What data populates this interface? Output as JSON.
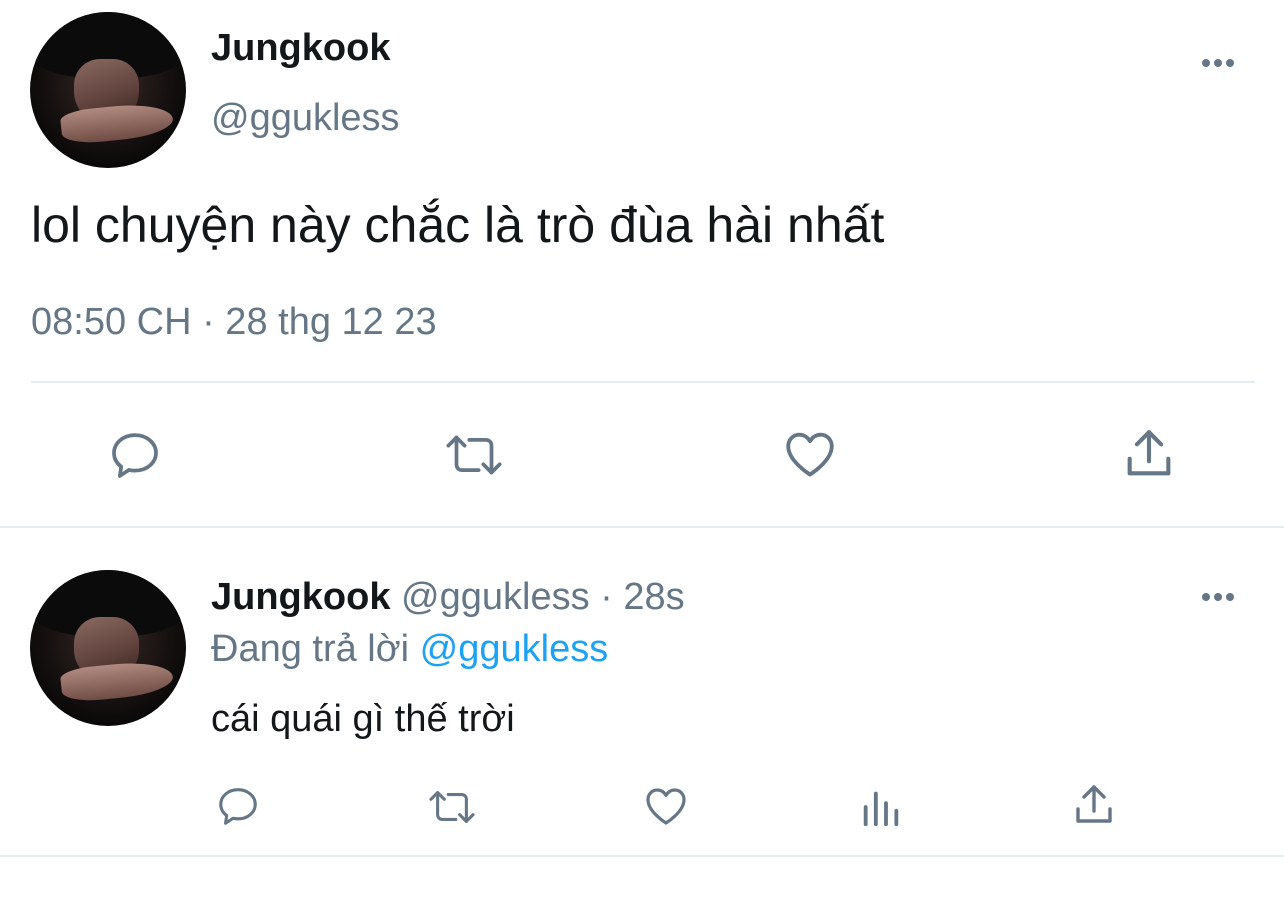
{
  "tweet": {
    "author_name": "Jungkook",
    "handle": "@ggukless",
    "text": "lol chuyện này chắc là trò đùa hài nhất",
    "timestamp": "08:50 CH · 28 thg 12 23",
    "actions": [
      "reply-icon",
      "retweet-icon",
      "like-icon",
      "share-icon"
    ]
  },
  "reply": {
    "author_name": "Jungkook",
    "handle": "@ggukless",
    "separator": "·",
    "age": "28s",
    "replying_prefix": "Đang trả lời",
    "replying_to": "@ggukless",
    "text": "cái quái gì thế trời",
    "actions": [
      "reply-icon",
      "retweet-icon",
      "like-icon",
      "analytics-icon",
      "share-icon"
    ]
  },
  "colors": {
    "text": "#14171a",
    "secondary": "#657786",
    "accent": "#1da1f2",
    "divider": "#e6ecf0"
  }
}
